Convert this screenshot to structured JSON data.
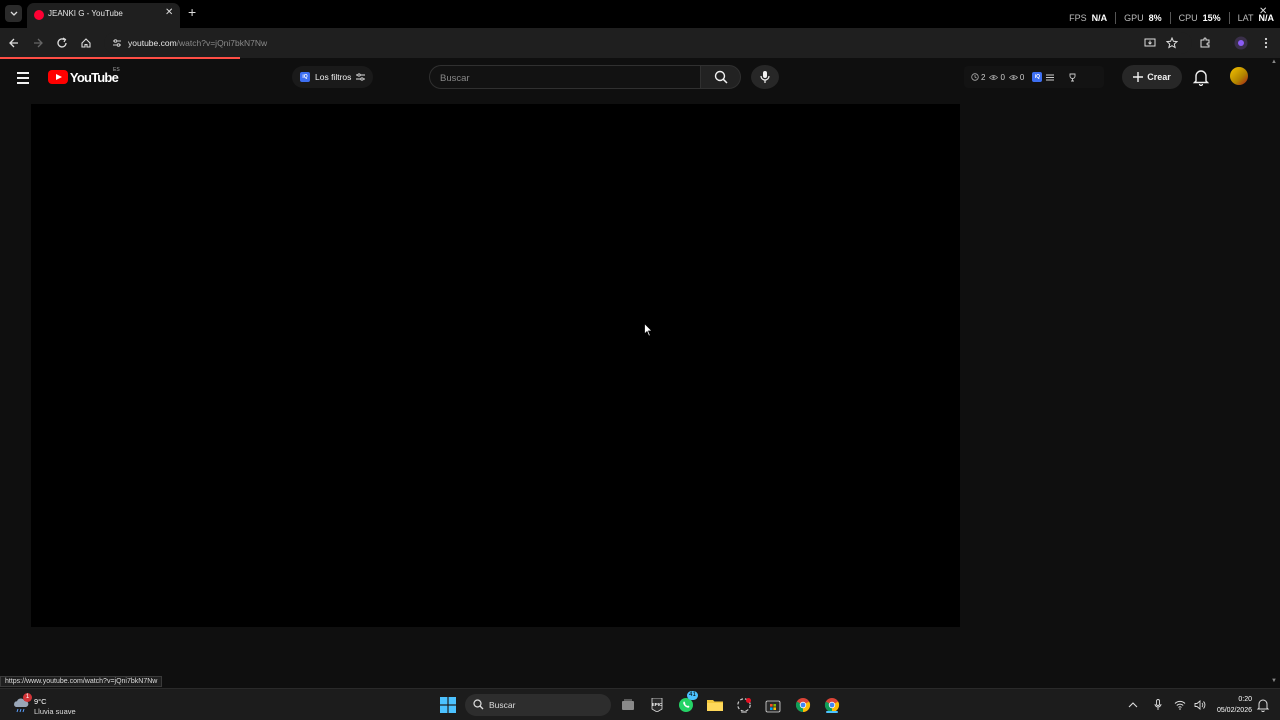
{
  "browser": {
    "tab": {
      "title": "JEANKI G - YouTube"
    },
    "perf": [
      {
        "label": "FPS",
        "value": "N/A"
      },
      {
        "label": "GPU",
        "value": "8%"
      },
      {
        "label": "CPU",
        "value": "15%"
      },
      {
        "label": "LAT",
        "value": "N/A"
      }
    ],
    "url": {
      "host": "youtube.com",
      "path": "/watch?v=jQni7bkN7Nw"
    },
    "status_url": "https://www.youtube.com/watch?v=jQni7bkN7Nw"
  },
  "masthead": {
    "logo_text": "YouTube",
    "country_code": "ES",
    "filters_label": "Los filtros",
    "search_placeholder": "Buscar",
    "ext_stats": [
      "2",
      "0",
      "0"
    ],
    "create_label": "Crear"
  },
  "taskbar": {
    "weather_temp": "9°C",
    "weather_desc": "Lluvia suave",
    "weather_badge": "1",
    "search_label": "Buscar",
    "whatsapp_badge": "41",
    "time": "0:20",
    "date": "05/02/2026"
  },
  "colors": {
    "youtube_red": "#ff0000",
    "load_bar": "#ff4e45",
    "background": "#0f0f0f",
    "player": "#000000"
  }
}
